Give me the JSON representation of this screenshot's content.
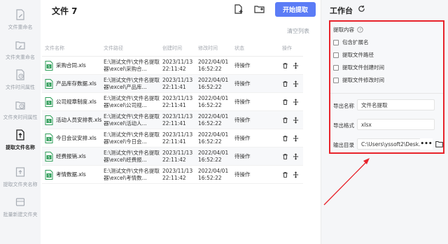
{
  "sidebar": {
    "items": [
      {
        "label": "文件重命名",
        "icon": "file-rename-icon",
        "active": false
      },
      {
        "label": "文件夹重命名",
        "icon": "folder-rename-icon",
        "active": false
      },
      {
        "label": "文件时间属性",
        "icon": "file-time-icon",
        "active": false
      },
      {
        "label": "文件夹时间属性",
        "icon": "folder-time-icon",
        "active": false
      },
      {
        "label": "提取文件名称",
        "icon": "extract-filename-icon",
        "active": true
      },
      {
        "label": "提取文件夹名称",
        "icon": "extract-foldername-icon",
        "active": false
      },
      {
        "label": "批量新建文件夹",
        "icon": "batch-new-folder-icon",
        "active": false
      }
    ]
  },
  "main": {
    "title": "文件 7",
    "add_file_icon": "add-file-icon",
    "add_folder_icon": "add-folder-icon",
    "start_button": "开始提取",
    "clear_list": "清空列表",
    "columns": [
      "文件名称",
      "文件路径",
      "创建时间",
      "修改时间",
      "状态",
      "操作"
    ],
    "rows": [
      {
        "name": "采购合同.xls",
        "path": "E:\\测试文件\\文件名提取器\\excel\\采购合...",
        "created": "2023/11/13 22:11:42",
        "modified": "2022/04/01 16:52:22",
        "status": "待操作"
      },
      {
        "name": "产品库存数据.xls",
        "path": "E:\\测试文件\\文件名提取器\\excel\\产品库...",
        "created": "2023/11/13 22:11:41",
        "modified": "2022/04/01 16:52:22",
        "status": "待操作"
      },
      {
        "name": "公司规章制度.xls",
        "path": "E:\\测试文件\\文件名提取器\\excel\\公司规...",
        "created": "2023/11/13 22:11:41",
        "modified": "2022/04/01 16:52:22",
        "status": "待操作"
      },
      {
        "name": "活动人员安排表.xls",
        "path": "E:\\测试文件\\文件名提取器\\excel\\活动人...",
        "created": "2023/11/13 22:11:41",
        "modified": "2022/04/01 16:52:22",
        "status": "待操作"
      },
      {
        "name": "今日会议安排.xls",
        "path": "E:\\测试文件\\文件名提取器\\excel\\今日会...",
        "created": "2023/11/13 22:11:41",
        "modified": "2022/04/01 16:52:22",
        "status": "待操作"
      },
      {
        "name": "经费报销.xls",
        "path": "E:\\测试文件\\文件名提取器\\excel\\经费报...",
        "created": "2023/11/13 22:11:42",
        "modified": "2022/04/01 16:52:22",
        "status": "待操作"
      },
      {
        "name": "考情数据.xls",
        "path": "E:\\测试文件\\文件名提取器\\excel\\考情数...",
        "created": "2023/11/13 22:11:42",
        "modified": "2022/04/01 16:52:22",
        "status": "待操作"
      }
    ]
  },
  "workbench": {
    "title": "工作台",
    "content_title": "提取内容",
    "options": [
      {
        "label": "包含扩展名",
        "checked": false
      },
      {
        "label": "提取文件路径",
        "checked": false
      },
      {
        "label": "提取文件创建时间",
        "checked": false
      },
      {
        "label": "提取文件修改时间",
        "checked": false
      }
    ],
    "export_name_label": "导出名称",
    "export_name_value": "文件名提取",
    "export_format_label": "导出格式",
    "export_format_value": "xlsx",
    "output_dir_label": "输出目录",
    "output_dir_value": "C:\\Users\\yssoft2\\Desk...",
    "dots": "•••"
  },
  "colors": {
    "accent": "#5b7cf6",
    "highlight": "#e8232b",
    "excel_green": "#2e9d58"
  }
}
